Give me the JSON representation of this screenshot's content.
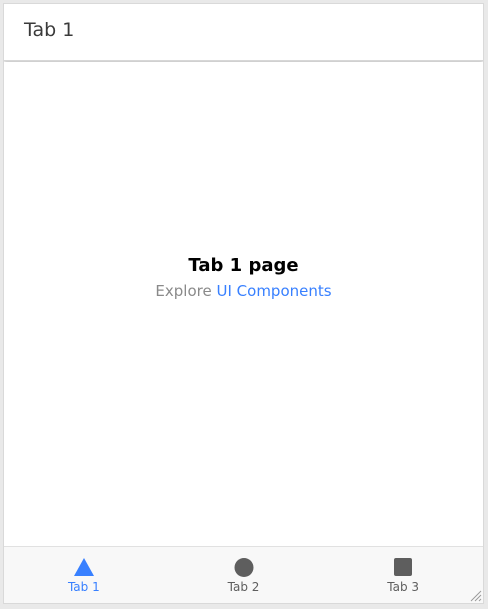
{
  "header": {
    "title": "Tab 1"
  },
  "content": {
    "page_title": "Tab 1 page",
    "explore_text": "Explore",
    "link_text": "UI Components"
  },
  "tabs": [
    {
      "label": "Tab 1",
      "icon": "triangle-icon",
      "active": true
    },
    {
      "label": "Tab 2",
      "icon": "circle-icon",
      "active": false
    },
    {
      "label": "Tab 3",
      "icon": "square-icon",
      "active": false
    }
  ],
  "colors": {
    "accent": "#3880ff",
    "inactive_tab": "#5e5e5e",
    "tabbar_background": "#f8f8f8"
  }
}
